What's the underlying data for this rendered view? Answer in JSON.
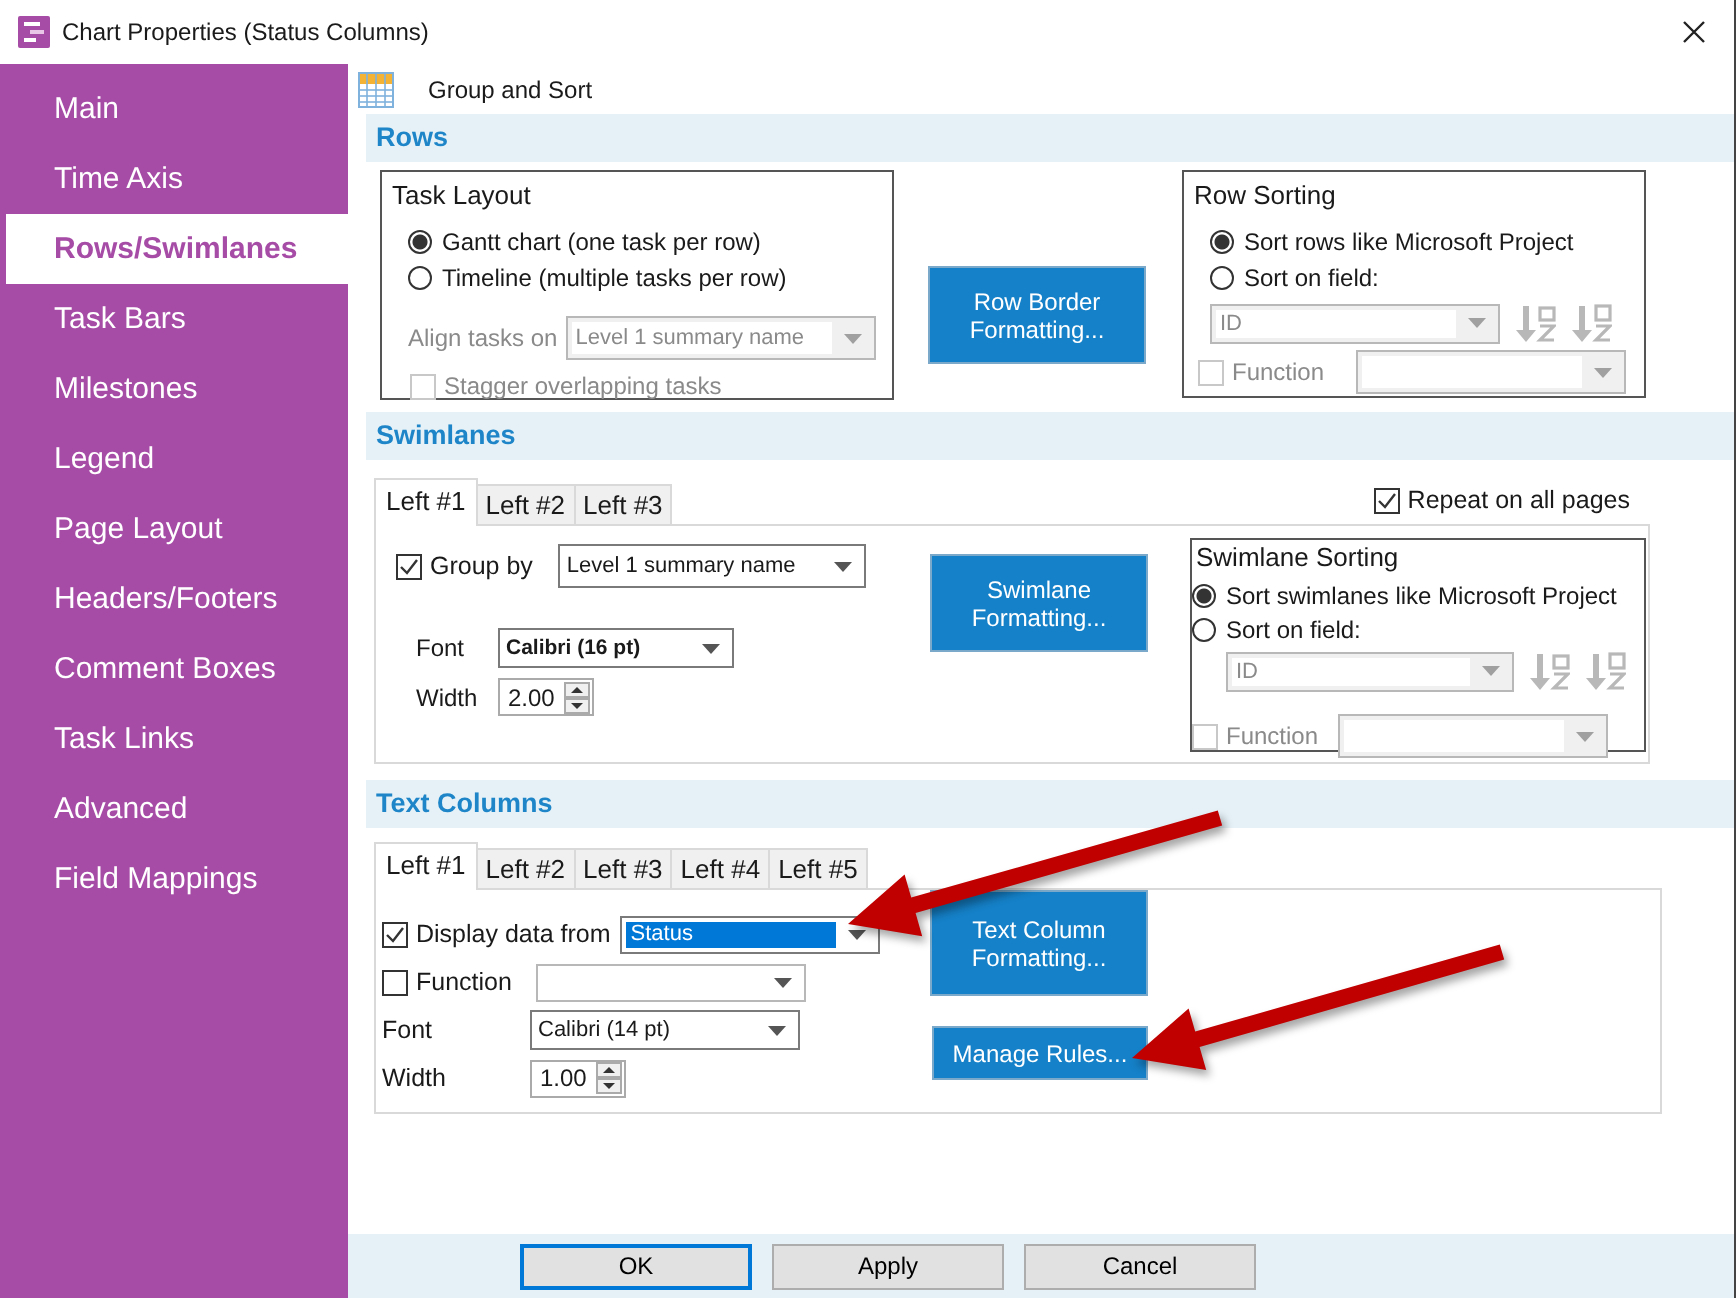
{
  "window": {
    "title": "Chart Properties (Status Columns)"
  },
  "sidebar": {
    "items": [
      {
        "label": "Main",
        "selected": false
      },
      {
        "label": "Time Axis",
        "selected": false
      },
      {
        "label": "Rows/Swimlanes",
        "selected": true
      },
      {
        "label": "Task Bars",
        "selected": false
      },
      {
        "label": "Milestones",
        "selected": false
      },
      {
        "label": "Legend",
        "selected": false
      },
      {
        "label": "Page Layout",
        "selected": false
      },
      {
        "label": "Headers/Footers",
        "selected": false
      },
      {
        "label": "Comment Boxes",
        "selected": false
      },
      {
        "label": "Task Links",
        "selected": false
      },
      {
        "label": "Advanced",
        "selected": false
      },
      {
        "label": "Field Mappings",
        "selected": false
      }
    ]
  },
  "page_title": "Group and Sort",
  "rows": {
    "heading": "Rows",
    "task_layout": {
      "title": "Task Layout",
      "options": [
        {
          "label": "Gantt chart (one task per row)",
          "selected": true
        },
        {
          "label": "Timeline (multiple tasks per row)",
          "selected": false
        }
      ],
      "align": {
        "label": "Align tasks on",
        "value": "Level 1 summary name",
        "disabled": true
      },
      "stagger": {
        "label": "Stagger overlapping tasks",
        "checked": false,
        "disabled": true
      }
    },
    "button": "Row Border Formatting...",
    "sorting": {
      "title": "Row Sorting",
      "options": [
        {
          "label": "Sort rows like Microsoft Project",
          "selected": true
        },
        {
          "label": "Sort on field:",
          "selected": false
        }
      ],
      "field": {
        "value": "ID",
        "disabled": true
      },
      "function": {
        "label": "Function",
        "checked": false,
        "disabled": true
      }
    }
  },
  "swimlanes": {
    "heading": "Swimlanes",
    "tabs": [
      {
        "label": "Left #1",
        "selected": true
      },
      {
        "label": "Left #2",
        "selected": false
      },
      {
        "label": "Left #3",
        "selected": false
      }
    ],
    "repeat": {
      "label": "Repeat on all pages",
      "checked": true
    },
    "group_by": {
      "label": "Group by",
      "checked": true,
      "value": "Level 1 summary name"
    },
    "font": {
      "label": "Font",
      "value": "Calibri (16 pt)"
    },
    "width": {
      "label": "Width",
      "value": "2.00"
    },
    "button": "Swimlane Formatting...",
    "sorting": {
      "title": "Swimlane Sorting",
      "options": [
        {
          "label": "Sort swimlanes like Microsoft Project",
          "selected": true
        },
        {
          "label": "Sort on field:",
          "selected": false
        }
      ],
      "field": {
        "value": "ID",
        "disabled": true
      },
      "function": {
        "label": "Function",
        "checked": false,
        "disabled": true
      }
    }
  },
  "text_columns": {
    "heading": "Text Columns",
    "tabs": [
      {
        "label": "Left #1",
        "selected": true
      },
      {
        "label": "Left #2",
        "selected": false
      },
      {
        "label": "Left #3",
        "selected": false
      },
      {
        "label": "Left #4",
        "selected": false
      },
      {
        "label": "Left #5",
        "selected": false
      }
    ],
    "display": {
      "label": "Display data from",
      "checked": true,
      "value": "Status",
      "highlighted": true
    },
    "function": {
      "label": "Function",
      "checked": false
    },
    "font": {
      "label": "Font",
      "value": "Calibri (14 pt)"
    },
    "width": {
      "label": "Width",
      "value": "1.00"
    },
    "buttons": [
      "Text Column Formatting...",
      "Manage Rules..."
    ]
  },
  "footer": {
    "buttons": [
      {
        "label": "OK",
        "default": true
      },
      {
        "label": "Apply",
        "default": false
      },
      {
        "label": "Cancel",
        "default": false
      }
    ]
  }
}
